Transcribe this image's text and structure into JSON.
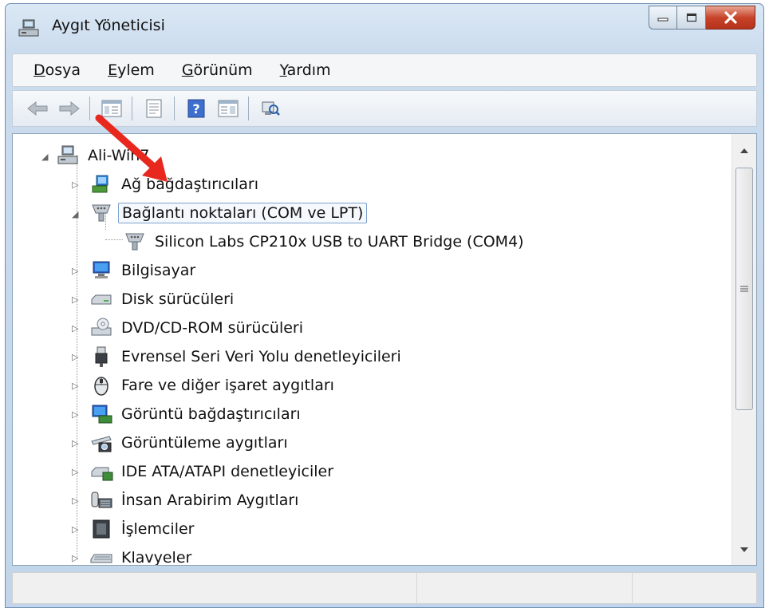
{
  "window": {
    "title": "Aygıt Yöneticisi",
    "controls": [
      "minimize",
      "maximize",
      "close"
    ]
  },
  "menu": [
    {
      "label": "Dosya",
      "accel": "D",
      "rest": "osya"
    },
    {
      "label": "Eylem",
      "accel": "E",
      "rest": "ylem"
    },
    {
      "label": "Görünüm",
      "accel": "G",
      "rest": "örünüm"
    },
    {
      "label": "Yardım",
      "accel": "Y",
      "rest": "ardım"
    }
  ],
  "toolbar": {
    "icons": [
      "back-icon",
      "forward-icon",
      "console-tree-icon",
      "properties-icon",
      "help-icon",
      "action-pane-icon",
      "scan-hardware-icon"
    ]
  },
  "tree": {
    "root": "Ali-Win7",
    "items": [
      {
        "label": "Ağ bağdaştırıcıları",
        "icon": "network-adapter-icon",
        "expanded": false
      },
      {
        "label": "Bağlantı noktaları (COM ve LPT)",
        "icon": "port-icon",
        "expanded": true,
        "selected": true
      },
      {
        "label": "Silicon Labs CP210x USB to UART Bridge (COM4)",
        "icon": "port-device-icon",
        "child": true
      },
      {
        "label": "Bilgisayar",
        "icon": "computer-icon",
        "expanded": false
      },
      {
        "label": "Disk sürücüleri",
        "icon": "disk-drive-icon",
        "expanded": false
      },
      {
        "label": "DVD/CD-ROM sürücüleri",
        "icon": "dvd-icon",
        "expanded": false
      },
      {
        "label": "Evrensel Seri Veri Yolu denetleyicileri",
        "icon": "usb-icon",
        "expanded": false
      },
      {
        "label": "Fare ve diğer işaret aygıtları",
        "icon": "mouse-icon",
        "expanded": false
      },
      {
        "label": "Görüntü bağdaştırıcıları",
        "icon": "display-adapter-icon",
        "expanded": false
      },
      {
        "label": "Görüntüleme aygıtları",
        "icon": "imaging-device-icon",
        "expanded": false
      },
      {
        "label": "IDE ATA/ATAPI denetleyiciler",
        "icon": "ide-controller-icon",
        "expanded": false
      },
      {
        "label": "İnsan Arabirim Aygıtları",
        "icon": "hid-icon",
        "expanded": false
      },
      {
        "label": "İşlemciler",
        "icon": "processor-icon",
        "expanded": false
      },
      {
        "label": "Klavyeler",
        "icon": "keyboard-icon",
        "expanded": false
      }
    ]
  },
  "colors": {
    "annotation_arrow": "#e8281e",
    "selection_border": "#7da2ce",
    "close_button": "#c7442a"
  }
}
